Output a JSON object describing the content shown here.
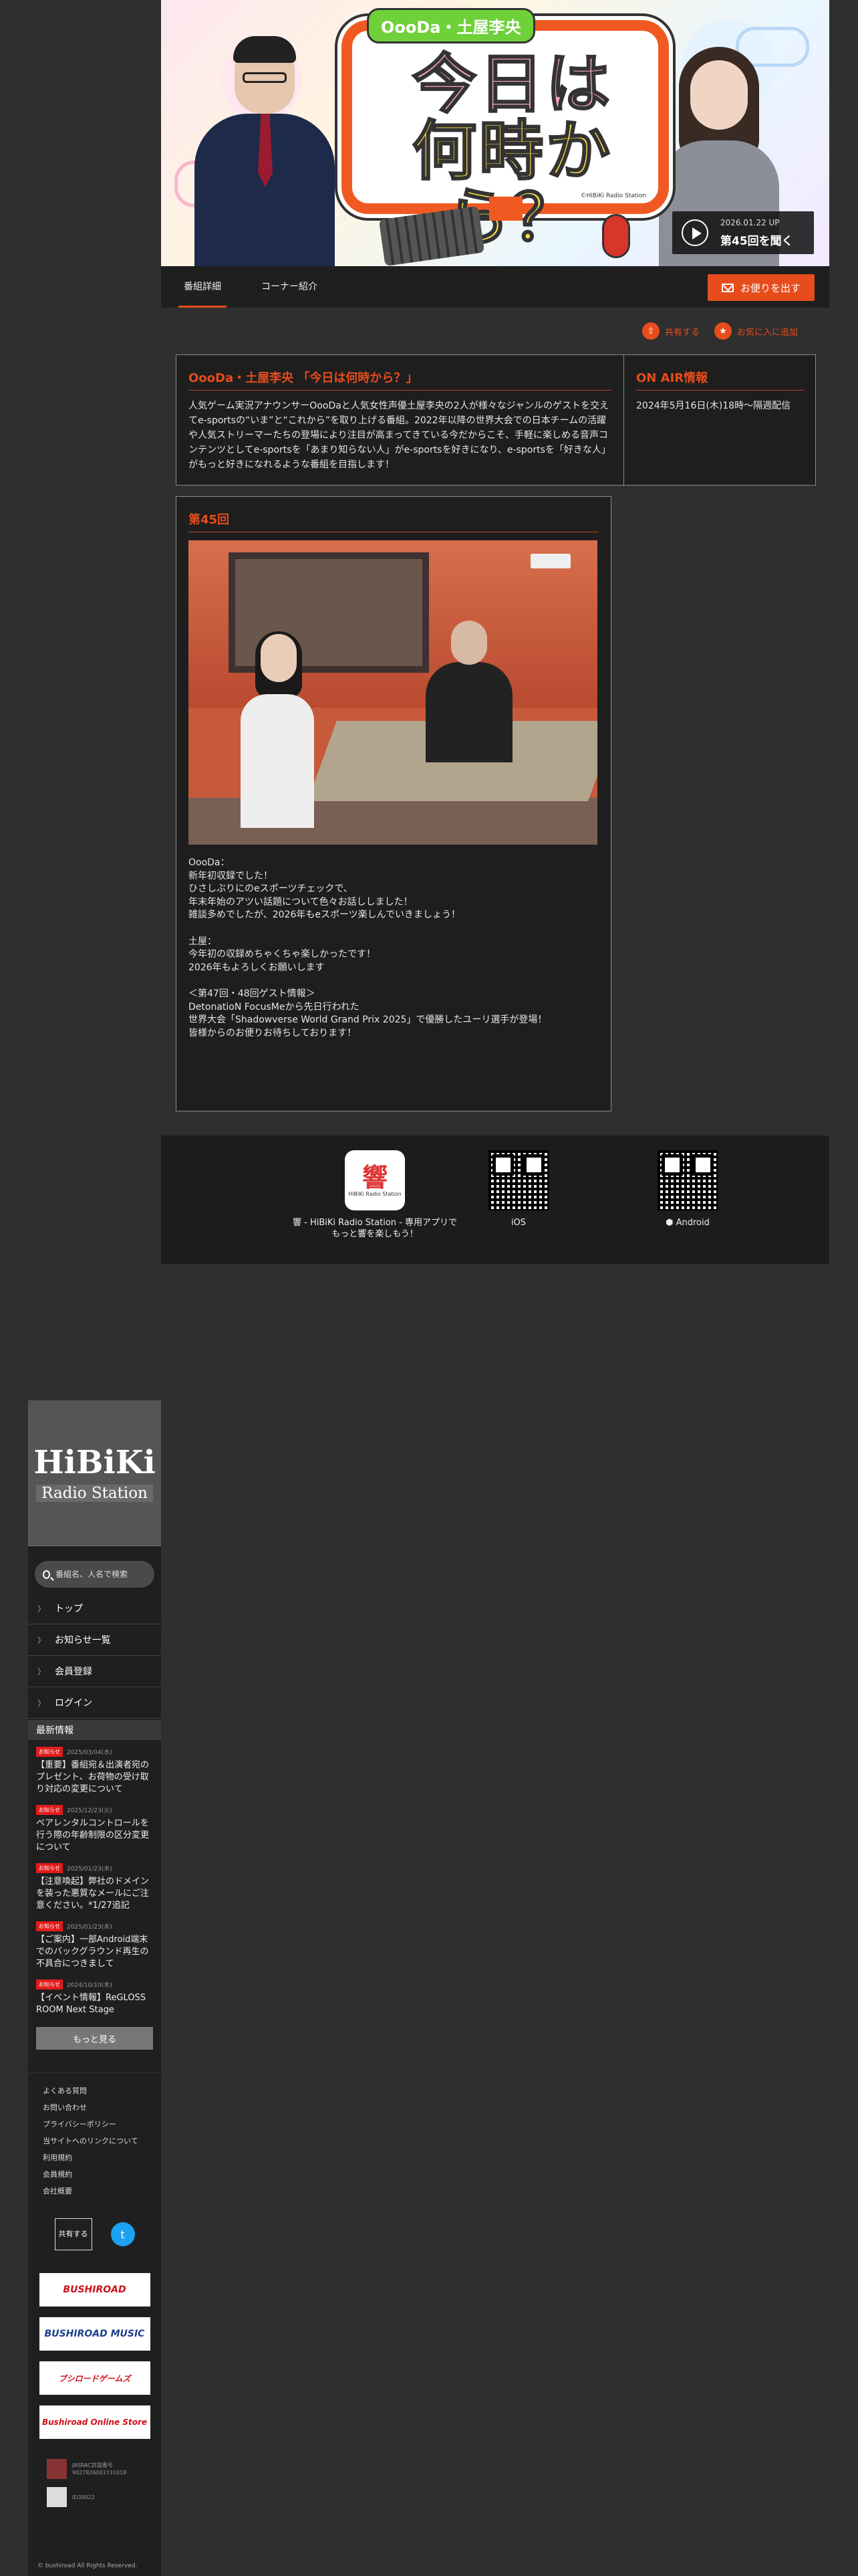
{
  "hero": {
    "tag": "OooDa・土屋李央",
    "title_line1": "今日は",
    "title_line2": "何時から？",
    "credit": "©HiBiKi Radio Station",
    "date": "2026.01.22 UP",
    "episode_link": "第45回を聞く"
  },
  "tabs": [
    "番組詳細",
    "コーナー紹介"
  ],
  "mail_button": "お便りを出す",
  "actions": {
    "share": "共有する",
    "favorite": "お気に入に追加"
  },
  "program": {
    "title": "OooDa・土屋李央 「今日は何時から？」",
    "description": "人気ゲーム実況アナウンサーOooDaと人気女性声優土屋李央の2人が様々なジャンルのゲストを交えてe-sportsの“いま”と“これから”を取り上げる番組。2022年以降の世界大会での日本チームの活躍や人気ストリーマーたちの登場により注目が高まってきている今だからこそ、手軽に楽しめる音声コンテンツとしてe-sportsを「あまり知らない人」がe-sportsを好きになり、e-sportsを「好きな人」がもっと好きになれるような番組を目指します！"
  },
  "onair": {
    "title": "ON AIR情報",
    "text": "2024年5月16日(木)18時〜隔週配信"
  },
  "episode": {
    "title": "第45回",
    "text": "OooDa：\n新年初収録でした！\nひさしぶりにのeスポーツチェックで、\n年末年始のアツい話題について色々お話ししました！\n雑談多めでしたが、2026年もeスポーツ楽しんでいきましょう！\n\n土屋：\n今年初の収録めちゃくちゃ楽しかったです！\n2026年もよろしくお願いします\n\n＜第47回・48回ゲスト情報＞\nDetonatioN FocusMeから先日行われた\n世界大会「Shadowverse World Grand Prix 2025」で優勝したユーリ選手が登場！\n皆様からのお便りお待ちしております！"
  },
  "apps": {
    "app_icon_text": "響",
    "app_icon_sub": "HiBiKi Radio Station",
    "app_caption": "響 - HiBiKi Radio Station - 専用アプリで\nもっと響を楽しもう！",
    "ios": "iOS",
    "android": "Android"
  },
  "sidebar": {
    "brand_big": "HiBiKi",
    "brand_sub": "Radio Station",
    "search_placeholder": "番組名、人名で検索",
    "nav": [
      "トップ",
      "お知らせ一覧",
      "会員登録",
      "ログイン"
    ],
    "news_heading": "最新情報",
    "news": [
      {
        "badge": "お知らせ",
        "date": "2025/03/04(水)",
        "title": "【重要】番組宛＆出演者宛のプレゼント、お荷物の受け取り対応の変更について"
      },
      {
        "badge": "お知らせ",
        "date": "2025/12/23(火)",
        "title": "ペアレンタルコントロールを行う際の年齢制限の区分変更について"
      },
      {
        "badge": "お知らせ",
        "date": "2025/01/23(木)",
        "title": "【注意喚起】弊社のドメインを装った悪質なメールにご注意ください。*1/27追記"
      },
      {
        "badge": "お知らせ",
        "date": "2025/01/23(木)",
        "title": "【ご案内】一部Android端末でのバックグラウンド再生の不具合につきまして"
      },
      {
        "badge": "お知らせ",
        "date": "2024/10/10(木)",
        "title": "【イベント情報】ReGLOSS ROOM Next Stage"
      }
    ],
    "more": "もっと見る",
    "links": [
      "よくある質問",
      "お問い合わせ",
      "プライバシーポリシー",
      "当サイトへのリンクについて",
      "利用規約",
      "会員規約",
      "会社概要"
    ],
    "share": "共有する",
    "banners": [
      "BUSHIROAD",
      "BUSHIROAD MUSIC",
      "ブシロードゲームズ",
      "Bushiroad Online Store"
    ],
    "cert1": "JASRAC許諾番号\n9027826001Y31018",
    "cert2": "ID30022",
    "copyright": "© bushiroad All Rights Reserved."
  },
  "colors": {
    "accent": "#e74c1c",
    "page_bg": "#2f2f2f",
    "panel_bg": "#1e1e1e"
  }
}
